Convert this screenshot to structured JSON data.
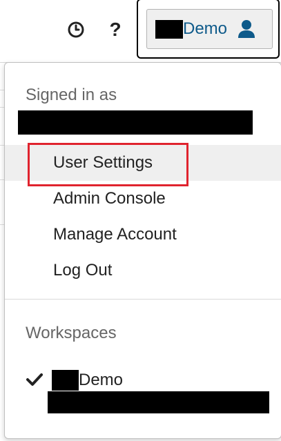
{
  "header": {
    "history_icon": "history-clock-icon",
    "help_icon": "question-mark-icon",
    "help_glyph": "?",
    "user_button": {
      "label": "Demo",
      "icon": "user-icon",
      "accent": "#0e5a8a"
    }
  },
  "dropdown": {
    "signed_in_label": "Signed in as",
    "menu_items": [
      {
        "label": "User Settings",
        "highlighted": true
      },
      {
        "label": "Admin Console"
      },
      {
        "label": "Manage Account"
      },
      {
        "label": "Log Out"
      }
    ],
    "highlight_color": "#e0232e",
    "workspaces_label": "Workspaces",
    "workspaces": [
      {
        "label": "Demo",
        "selected": true,
        "check_icon": "checkmark-icon"
      }
    ]
  }
}
